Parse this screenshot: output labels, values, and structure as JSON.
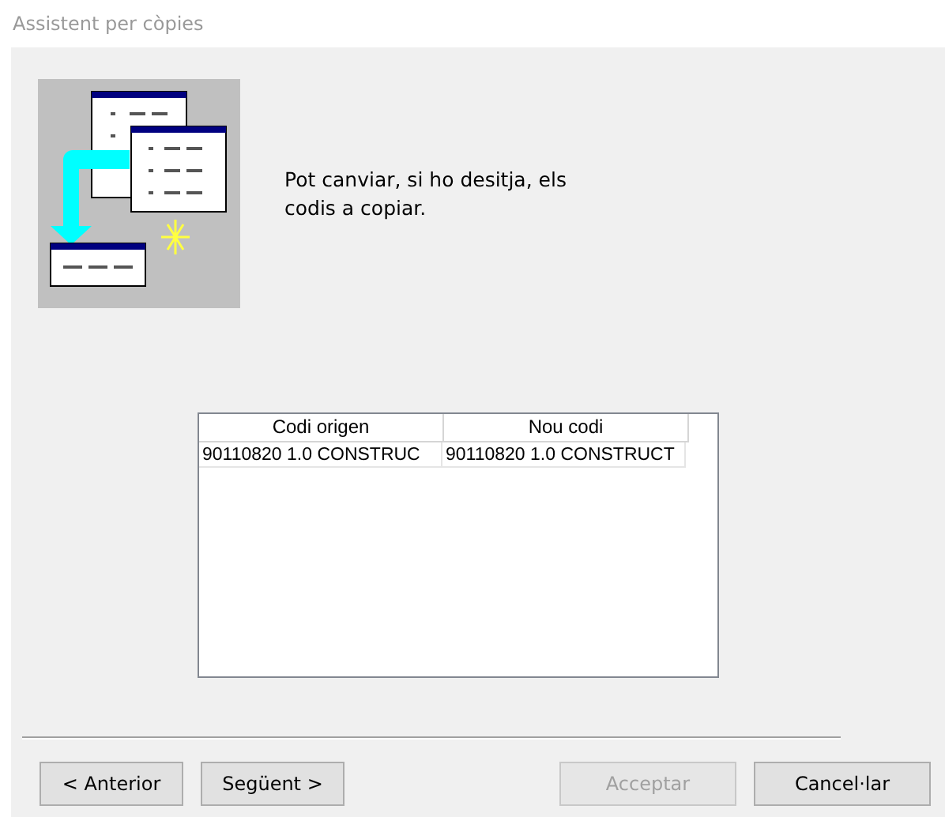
{
  "window": {
    "title": "Assistent per còpies"
  },
  "message": "Pot canviar, si ho desitja, els codis a copiar.",
  "table": {
    "columns": [
      "Codi origen",
      "Nou codi"
    ],
    "rows": [
      [
        "90110820 1.0 CONSTRUC",
        "90110820 1.0 CONSTRUCT"
      ]
    ]
  },
  "buttons": [
    {
      "label": "< Anterior",
      "disabled": false
    },
    {
      "label": "Següent >",
      "disabled": false
    },
    {
      "label": "Acceptar",
      "disabled": true
    },
    {
      "label": "Cancel·lar",
      "disabled": false
    }
  ]
}
